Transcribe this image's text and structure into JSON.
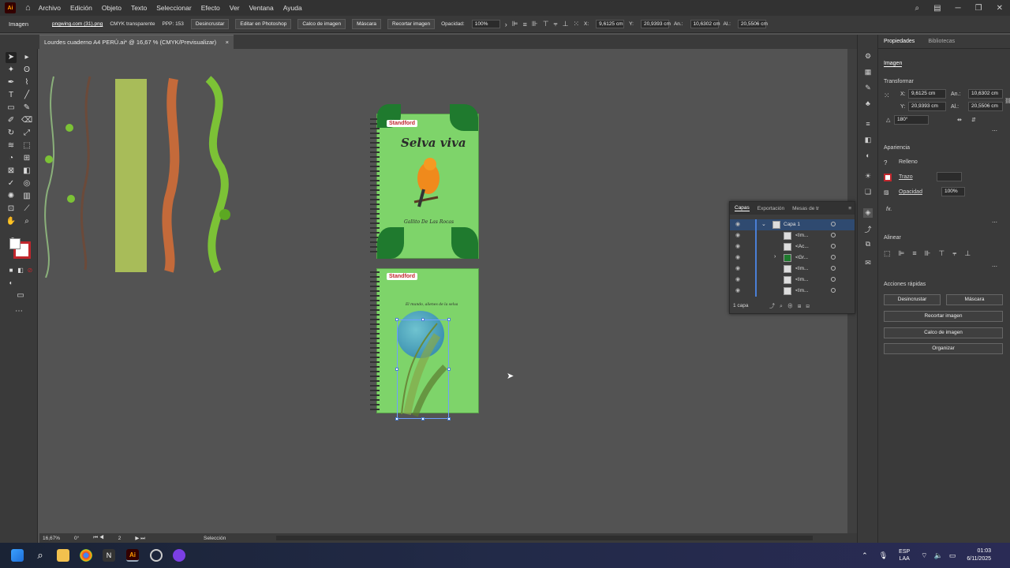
{
  "app": {
    "logo": "Ai",
    "home_icon": "home-icon"
  },
  "menu": [
    "Archivo",
    "Edición",
    "Objeto",
    "Texto",
    "Seleccionar",
    "Efecto",
    "Ver",
    "Ventana",
    "Ayuda"
  ],
  "control_bar": {
    "object_type": "Imagen",
    "file_name": "pngwing.com (31).png",
    "color_mode": "CMYK transparente",
    "ppp": "PPP: 153",
    "btn_desincrustar": "Desincrustar",
    "btn_photoshop": "Editar en Photoshop",
    "btn_calco": "Calco de imagen",
    "btn_mascara": "Máscara",
    "btn_recortar": "Recortar imagen",
    "opacity_label": "Opacidad:",
    "opacity_value": "100%",
    "x_label": "X:",
    "x_value": "9,6125 cm",
    "y_label": "Y:",
    "y_value": "20,9393 cm",
    "w_label": "An.:",
    "w_value": "10,6302 cm",
    "h_label": "Al.:",
    "h_value": "20,5506 cm"
  },
  "document_tab": {
    "title": "Lourdes cuaderno A4 PERÚ.ai* @ 16,67 % (CMYK/Previsualizar)",
    "close": "×"
  },
  "artwork": {
    "brand": "Standford",
    "cover_title": "Selva viva",
    "cover_caption": "Gallito De Las Rocas",
    "back_caption": "El mundo, alienes de la selva"
  },
  "layers_panel": {
    "tabs": [
      "Capas",
      "Exportación",
      "Mesas de tr"
    ],
    "layer_name": "Capa 1",
    "rows": [
      "<Im...",
      "<Ac...",
      "<Gr...",
      "<Im...",
      "<Im...",
      "<Im..."
    ],
    "footer": "1 capa"
  },
  "properties": {
    "tabs": [
      "Propiedades",
      "Bibliotecas"
    ],
    "object_type": "Imagen",
    "transform_title": "Transformar",
    "x_label": "X:",
    "x_value": "9,6125 cm",
    "y_label": "Y:",
    "y_value": "20,9393 cm",
    "w_label": "An.:",
    "w_value": "10,6302 cm",
    "h_label": "Al.:",
    "h_value": "20,5506 cm",
    "angle": "180°",
    "appearance_title": "Apariencia",
    "fill_label": "Relleno",
    "stroke_label": "Trazo",
    "opacity_label": "Opacidad",
    "opacity_value": "100%",
    "fx": "fx.",
    "align_title": "Alinear",
    "quick_title": "Acciones rápidas",
    "btn_desincrustar": "Desincrustar",
    "btn_mascara": "Máscara",
    "btn_recortar": "Recortar imagen",
    "btn_calco": "Calco de imagen",
    "btn_organizar": "Organizar"
  },
  "status_bar": {
    "zoom": "16,67%",
    "rotation": "0°",
    "artboard": "2",
    "tool": "Selección"
  },
  "taskbar": {
    "lang1": "ESP",
    "lang2": "LAA",
    "time": "01:03",
    "date": "6/11/2025"
  },
  "colors": {
    "accent": "#4a7fd6",
    "ai_orange": "#ff9a00",
    "notebook_green": "#7ed46a",
    "leaf_green": "#1f7a2e"
  }
}
